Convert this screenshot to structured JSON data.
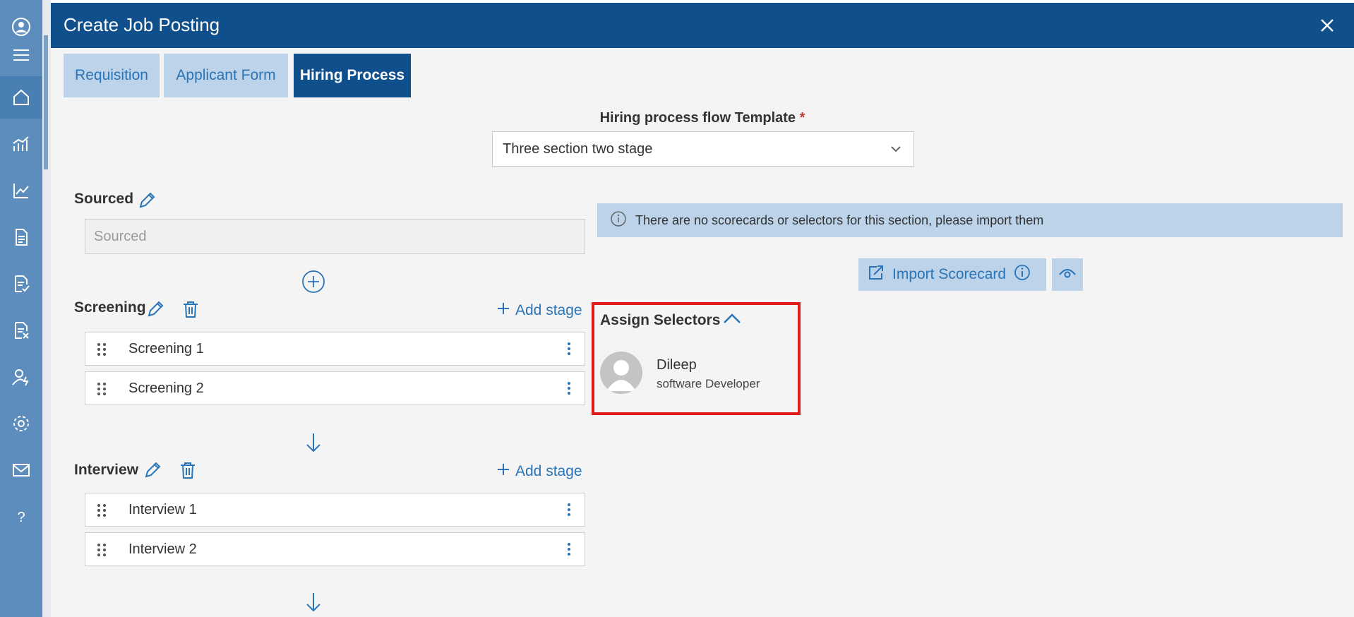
{
  "sidebar": {
    "items": [
      {
        "icon": "user-circle-icon"
      },
      {
        "icon": "hamburger-menu-icon"
      },
      {
        "icon": "home-icon"
      },
      {
        "icon": "bar-chart-icon"
      },
      {
        "icon": "line-chart-icon"
      },
      {
        "icon": "document-icon"
      },
      {
        "icon": "document-check-icon"
      },
      {
        "icon": "document-x-icon"
      },
      {
        "icon": "user-bolt-icon"
      },
      {
        "icon": "gear-icon"
      },
      {
        "icon": "mail-icon"
      },
      {
        "icon": "help-icon"
      }
    ],
    "active_index": 2
  },
  "modal": {
    "title": "Create Job Posting",
    "tabs": [
      {
        "label": "Requisition",
        "active": false
      },
      {
        "label": "Applicant Form",
        "active": false
      },
      {
        "label": "Hiring Process",
        "active": true
      }
    ]
  },
  "template": {
    "label": "Hiring process flow Template",
    "required_mark": "*",
    "selected": "Three section two stage"
  },
  "sourced": {
    "title": "Sourced",
    "placeholder": "Sourced"
  },
  "screening": {
    "title": "Screening",
    "add_stage_label": "Add stage",
    "stages": [
      "Screening 1",
      "Screening 2"
    ]
  },
  "interview": {
    "title": "Interview",
    "add_stage_label": "Add stage",
    "stages": [
      "Interview 1",
      "Interview 2"
    ]
  },
  "info_bar": {
    "text": "There are no scorecards or selectors for this section, please import them"
  },
  "scorecard": {
    "import_label": "Import Scorecard"
  },
  "selectors": {
    "title": "Assign Selectors",
    "people": [
      {
        "name": "Dileep",
        "role": "software Developer"
      }
    ]
  },
  "colors": {
    "header": "#0f4f8b",
    "accent": "#2a74b8",
    "light_accent": "#bcd3e9",
    "highlight": "#e01b1b",
    "sidebar": "#5c8dbd"
  }
}
